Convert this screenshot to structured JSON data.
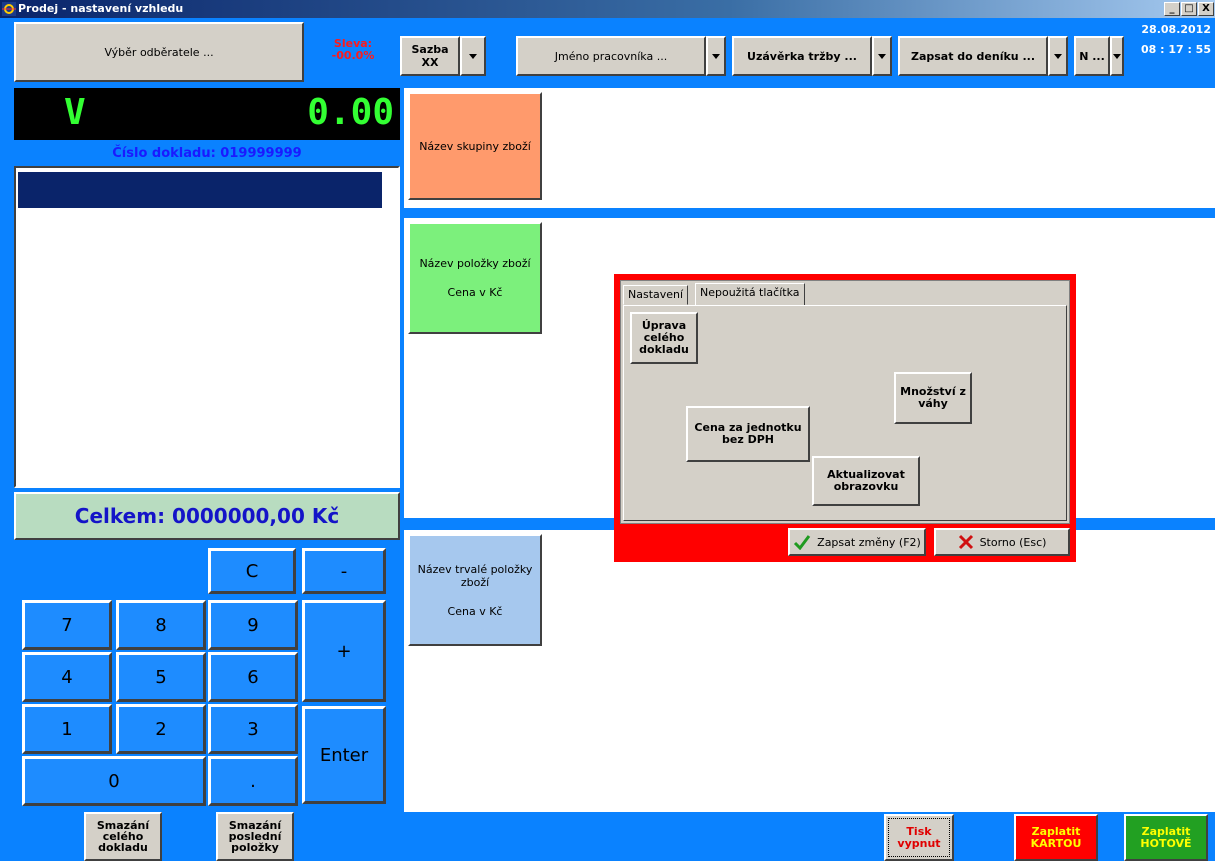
{
  "window": {
    "title": "Prodej - nastavení vzhledu",
    "minimize": "_",
    "maximize": "□",
    "close": "X"
  },
  "toolbar": {
    "customer": "Výběr odběratele ...",
    "discount_label": "Sleva:",
    "discount_value": "-00.0%",
    "rate": "Sazba XX",
    "employee": "Jméno pracovníka ...",
    "closing": "Uzávěrka tržby ...",
    "journal": "Zapsat do deníku ...",
    "n": "N ...",
    "date": "28.08.2012",
    "time": "08 : 17 : 55"
  },
  "display": {
    "mode": "V",
    "amount": "0.00"
  },
  "document_number": "Číslo dokladu: 019999999",
  "total": "Celkem: 0000000,00 Kč",
  "keypad": {
    "c": "C",
    "minus": "-",
    "plus": "+",
    "enter": "Enter",
    "k7": "7",
    "k8": "8",
    "k9": "9",
    "k4": "4",
    "k5": "5",
    "k6": "6",
    "k1": "1",
    "k2": "2",
    "k3": "3",
    "k0": "0",
    "dot": "."
  },
  "bottom": {
    "delete_doc_1": "Smazání",
    "delete_doc_2": "celého",
    "delete_doc_3": "dokladu",
    "delete_last_1": "Smazání",
    "delete_last_2": "poslední",
    "delete_last_3": "položky",
    "print_1": "Tisk",
    "print_2": "vypnut",
    "card_1": "Zaplatit",
    "card_2": "KARTOU",
    "cash_1": "Zaplatit",
    "cash_2": "HOTOVĚ"
  },
  "tiles": {
    "group": "Název skupiny zboží",
    "item_name": "Název položky zboží",
    "item_price": "Cena v Kč",
    "permanent_name": "Název trvalé položky zboží",
    "permanent_price": "Cena v Kč"
  },
  "dialog": {
    "tab_settings": "Nastavení",
    "tab_unused": "Nepoužitá tlačítka",
    "btn_edit_doc": "Úprava celého dokladu",
    "btn_qty_scale": "Množství z váhy",
    "btn_unit_price": "Cena za jednotku bez DPH",
    "btn_refresh": "Aktualizovat obrazovku",
    "save": "Zapsat změny (F2)",
    "cancel": "Storno (Esc)"
  },
  "colors": {
    "background": "#0a82ff",
    "group_tile": "#ff9a6c",
    "item_tile": "#7cf07c",
    "permanent_tile": "#a6c8ee",
    "dialog_border": "#ff0000",
    "display_text": "#33ff33",
    "card_button": "#ff0000",
    "cash_button": "#22a022"
  }
}
